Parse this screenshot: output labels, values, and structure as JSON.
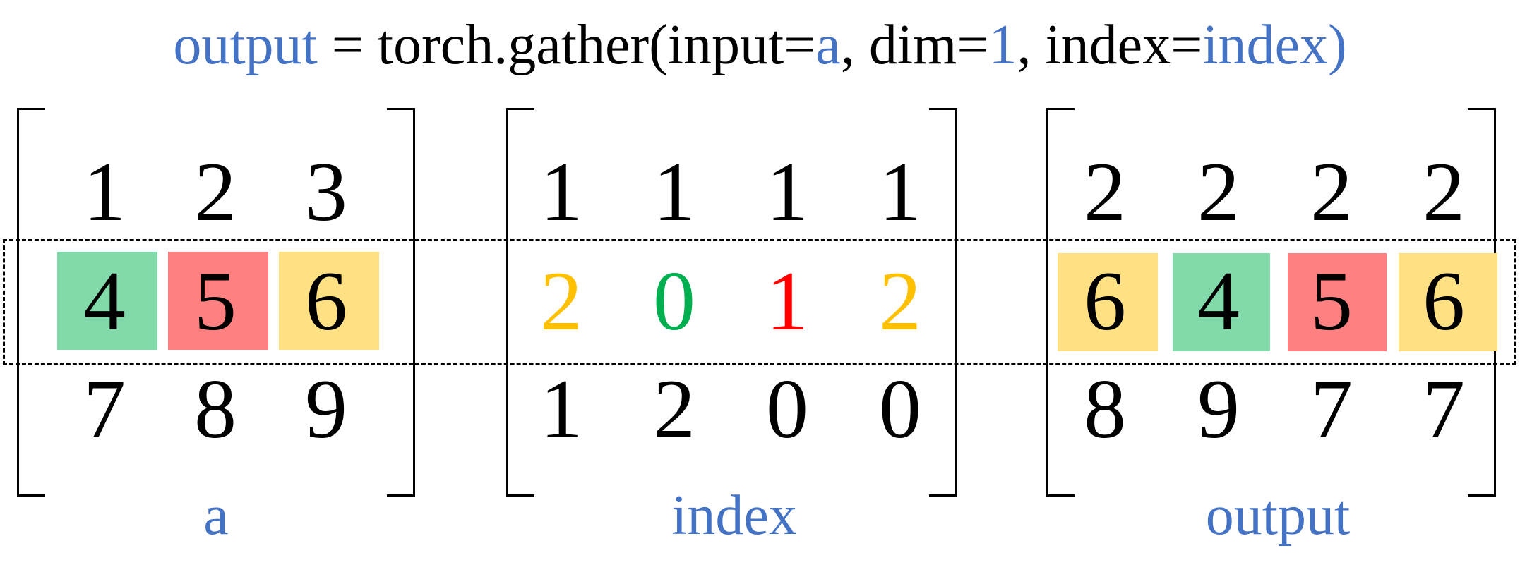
{
  "title": {
    "output": "output",
    "eq": " = torch.gather(input=",
    "a": "a",
    "dim_text": ", dim=",
    "dim_value": "1",
    "index_text": ", index=",
    "index_value": "index",
    "close": ")"
  },
  "colors": {
    "label_blue": "#4472c4",
    "green": "#82d9a9",
    "red": "#ff8080",
    "yellow": "#ffe083",
    "text_orange": "#ffc000",
    "text_green": "#00b050",
    "text_red": "#ff0000"
  },
  "matrices": {
    "a": {
      "label": "a",
      "row0": [
        "1",
        "2",
        "3"
      ],
      "row1": [
        "4",
        "5",
        "6"
      ],
      "row2": [
        "7",
        "8",
        "9"
      ]
    },
    "index": {
      "label": "index",
      "row0": [
        "1",
        "1",
        "1",
        "1"
      ],
      "row1": [
        "2",
        "0",
        "1",
        "2"
      ],
      "row2": [
        "1",
        "2",
        "0",
        "0"
      ]
    },
    "output": {
      "label": "output",
      "row0": [
        "2",
        "2",
        "2",
        "2"
      ],
      "row1": [
        "6",
        "4",
        "5",
        "6"
      ],
      "row2": [
        "8",
        "9",
        "7",
        "7"
      ]
    }
  }
}
